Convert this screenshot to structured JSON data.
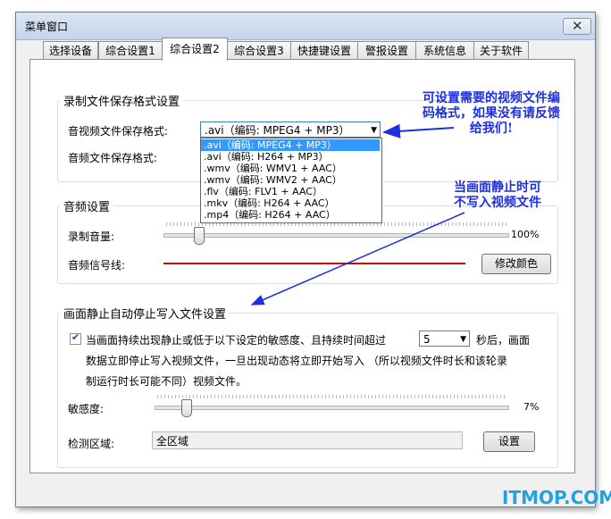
{
  "window": {
    "title": "菜单窗口",
    "close_glyph": "✕"
  },
  "tabs": [
    {
      "label": "选择设备"
    },
    {
      "label": "综合设置1"
    },
    {
      "label": "综合设置2"
    },
    {
      "label": "综合设置3"
    },
    {
      "label": "快捷键设置"
    },
    {
      "label": "警报设置"
    },
    {
      "label": "系统信息"
    },
    {
      "label": "关于软件"
    }
  ],
  "record_format": {
    "group_title": "录制文件保存格式设置",
    "av_label": "音视频文件保存格式:",
    "av_value": ".avi（编码: MPEG4 + MP3）",
    "audio_label": "音频文件保存格式:",
    "dropdown_options": [
      ".avi（编码: MPEG4 + MP3）",
      ".avi（编码: H264 + MP3）",
      ".wmv（编码: WMV1 + AAC）",
      ".wmv（编码: WMV2 + AAC）",
      ".flv（编码: FLV1 + AAC）",
      ".mkv（编码: H264 + AAC）",
      ".mp4（编码: H264 + AAC）"
    ]
  },
  "audio": {
    "group_title": "音频设置",
    "volume_label": "录制音量:",
    "volume_value": "100%",
    "volume_level": 0.1,
    "signal_label": "音频信号线:",
    "signal_color": "#cc0000",
    "change_color_button": "修改颜色"
  },
  "still": {
    "group_title": "画面静止自动停止写入文件设置",
    "checked": true,
    "desc_part1": "当画面持续出现静止或低于以下设定的敏感度、且持续时间超过",
    "seconds_value": "5",
    "desc_part2": "秒后，画面",
    "desc_line2": "数据立即停止写入视频文件，一旦出现动态将立即开始写入 （所以视频文件时长和该轮录",
    "desc_line3": "制运行时长可能不同）视频文件。",
    "sensitivity_label": "敏感度:",
    "sensitivity_value": "7%",
    "sensitivity_level": 0.07,
    "detect_label": "检测区域:",
    "detect_value": "全区域",
    "settings_button": "设置"
  },
  "annotations": {
    "note1_line1": "可设置需要的视频文件编",
    "note1_line2": "码格式，如果没有请反馈",
    "note1_line3": "给我们!",
    "note2_line1": "当画面静止时可",
    "note2_line2": "不写入视频文件",
    "color": "#1d2fe0"
  },
  "watermark": "ITMOP.COM"
}
